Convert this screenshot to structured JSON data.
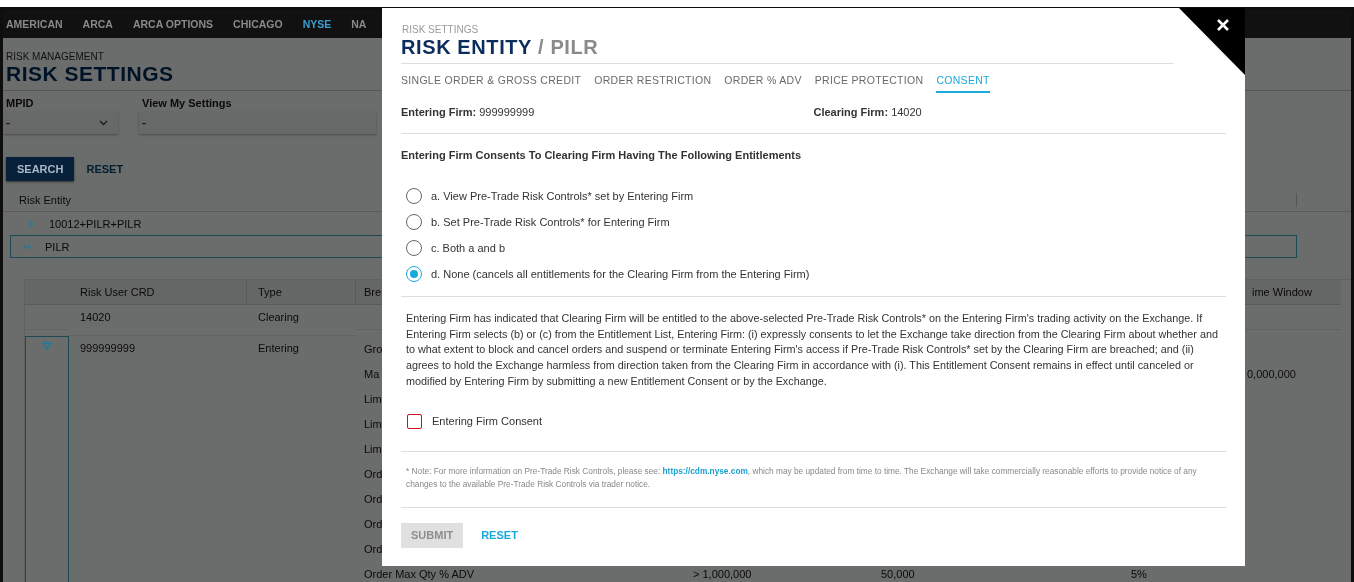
{
  "nav": {
    "items": [
      {
        "label": "AMERICAN",
        "selected": false
      },
      {
        "label": "ARCA",
        "selected": false
      },
      {
        "label": "ARCA OPTIONS",
        "selected": false
      },
      {
        "label": "CHICAGO",
        "selected": false
      },
      {
        "label": "NYSE",
        "selected": true
      },
      {
        "label": "NA",
        "selected": false
      }
    ]
  },
  "page": {
    "breadcrumb": "RISK MANAGEMENT",
    "title": "RISK SETTINGS",
    "filters": [
      {
        "label": "MPID",
        "value": "-"
      },
      {
        "label": "View My Settings",
        "value": "-"
      }
    ],
    "search_button": "SEARCH",
    "reset_link": "RESET",
    "entity_table": {
      "column": "Risk Entity",
      "rows": [
        {
          "label": "10012+PILR+PILR",
          "expanded": false
        },
        {
          "label": "PILR",
          "expanded": true
        }
      ]
    },
    "user_table": {
      "columns": [
        "Risk User CRD",
        "Type",
        "Bre",
        "ime Window"
      ],
      "rows": [
        {
          "crd": "14020",
          "type": "Clearing"
        },
        {
          "crd": "999999999",
          "type": "Entering",
          "expanded": true,
          "lines": [
            {
              "breach": "Gro"
            },
            {
              "breach": "Ma",
              "column_8": "0,000,000"
            },
            {
              "breach": "Lim"
            },
            {
              "breach": "Lim"
            },
            {
              "breach": "Lim"
            },
            {
              "breach": "Ord"
            },
            {
              "breach": "Ord"
            },
            {
              "breach": "Ord"
            },
            {
              "breach": "Ord"
            },
            {
              "breach": "Order Max Qty % ADV",
              "column_5": "> 1,000,000",
              "column_6": "50,000",
              "column_7": "5%"
            }
          ]
        }
      ]
    }
  },
  "modal": {
    "eyebrow": "RISK SETTINGS",
    "title": "RISK ENTITY",
    "subtitle": "/ PILR",
    "tabs": [
      {
        "label": "SINGLE ORDER & GROSS CREDIT",
        "selected": false
      },
      {
        "label": "ORDER RESTRICTION",
        "selected": false
      },
      {
        "label": "ORDER % ADV",
        "selected": false
      },
      {
        "label": "PRICE PROTECTION",
        "selected": false
      },
      {
        "label": "CONSENT",
        "selected": true
      }
    ],
    "firms": [
      {
        "label": "Entering Firm:",
        "value": "999999999"
      },
      {
        "label": "Clearing Firm:",
        "value": "14020"
      }
    ],
    "entitlements_heading": "Entering Firm Consents To Clearing Firm Having The Following Entitlements",
    "options": [
      {
        "label": "a. View Pre-Trade Risk Controls* set by Entering Firm",
        "selected": false
      },
      {
        "label": "b. Set Pre-Trade Risk Controls* for Entering Firm",
        "selected": false
      },
      {
        "label": "c. Both a and b",
        "selected": false
      },
      {
        "label": "d. None (cancels all entitlements for the Clearing Firm from the Entering Firm)",
        "selected": true
      }
    ],
    "disclaimer": "Entering Firm has indicated that Clearing Firm will be entitled to the above-selected Pre-Trade Risk Controls* on the Entering Firm's trading activity on the Exchange. If Entering Firm selects (b) or (c) from the Entitlement List, Entering Firm: (i) expressly consents to let the Exchange take direction from the Clearing Firm about whether and to what extent to block and cancel orders and suspend or terminate Entering Firm's access if Pre-Trade Risk Controls* set by the Clearing Firm are breached; and (ii) agrees to hold the Exchange harmless from direction taken from the Clearing Firm in accordance with (i). This Entitlement Consent remains in effect until canceled or modified by Entering Firm by submitting a new Entitlement Consent or by the Exchange.",
    "consent": {
      "label": "Entering Firm Consent",
      "checked": false
    },
    "note": {
      "before": "* Note: For more information on Pre-Trade Risk Controls, please see: ",
      "link": "https://cdm.nyse.com",
      "after": ", which may be updated from time to time. The Exchange will take commercially reasonable efforts to provide notice of any changes to the available Pre-Trade Risk Controls via trader notice."
    },
    "submit": {
      "label": "SUBMIT",
      "disabled": true
    },
    "reset": "RESET"
  }
}
